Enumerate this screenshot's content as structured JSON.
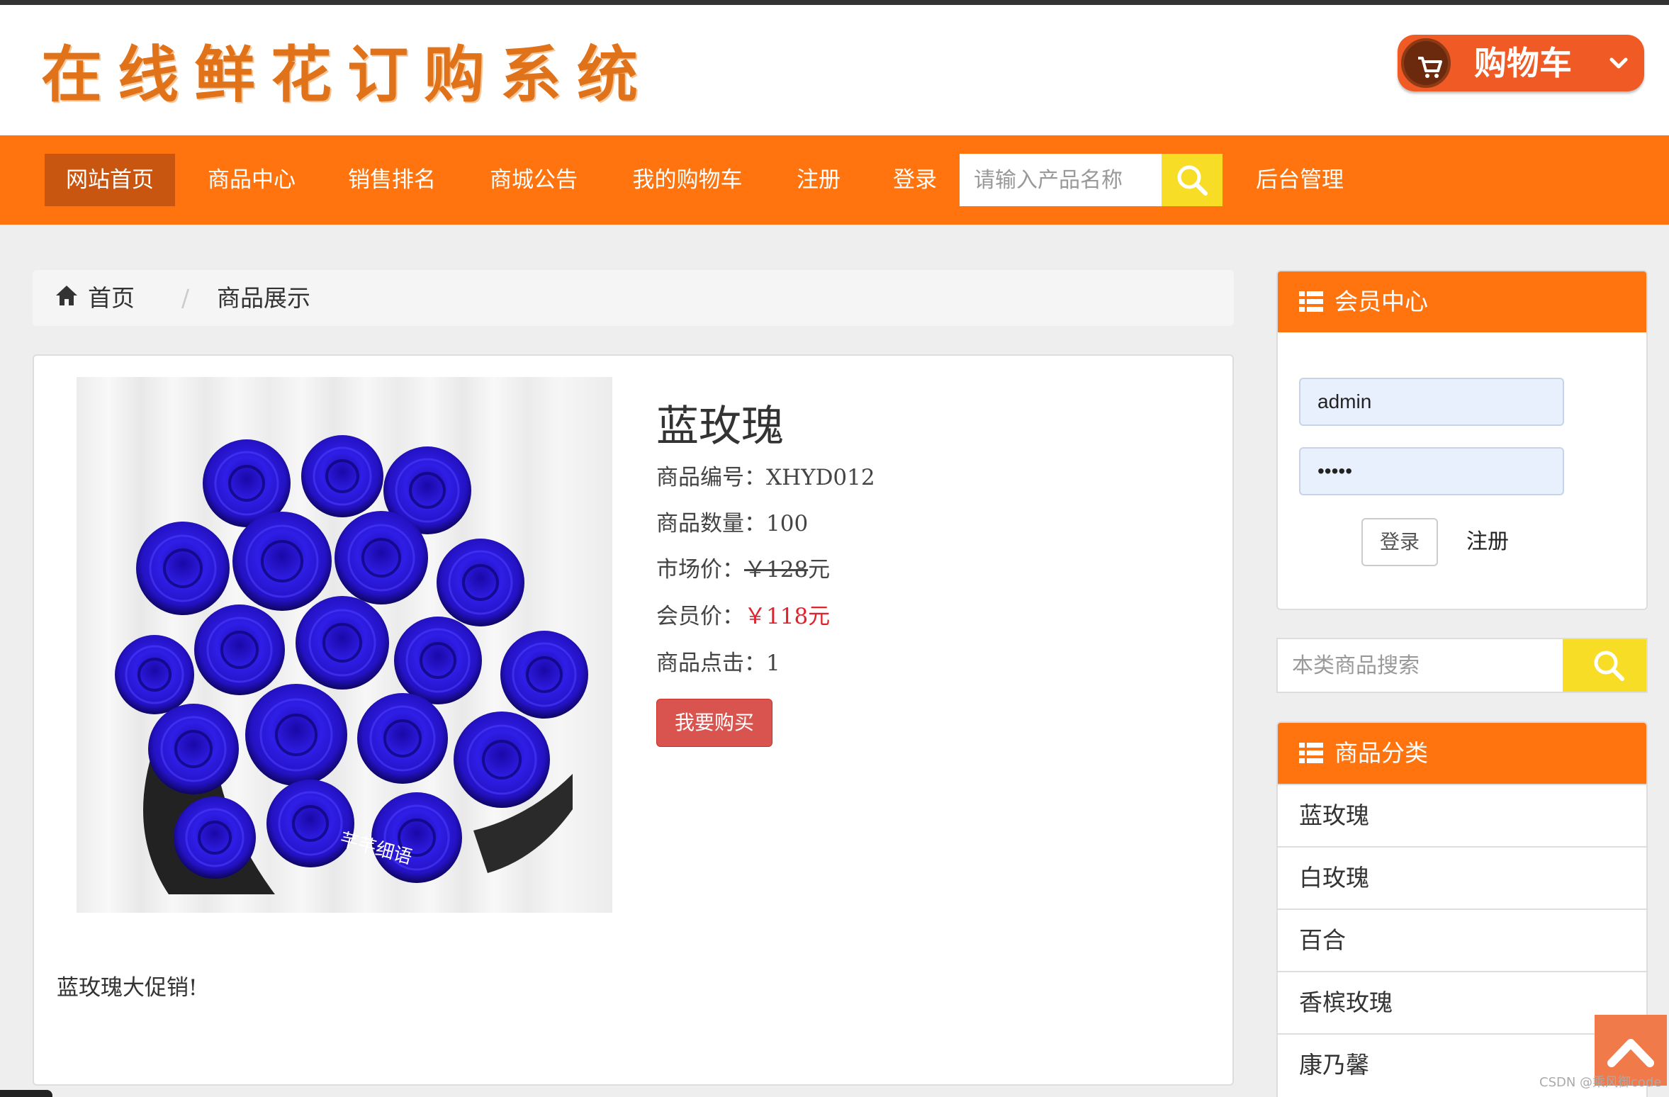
{
  "header": {
    "logo_text": "在线鲜花订购系统",
    "cart_label": "购物车"
  },
  "nav": {
    "items": [
      "网站首页",
      "商品中心",
      "销售排名",
      "商城公告",
      "我的购物车",
      "注册",
      "登录"
    ],
    "active_index": 0,
    "search_placeholder": "请输入产品名称",
    "admin_label": "后台管理"
  },
  "breadcrumb": {
    "home": "首页",
    "separator": "/",
    "current": "商品展示"
  },
  "product": {
    "name": "蓝玫瑰",
    "code_label": "商品编号：",
    "code": "XHYD012",
    "quantity_label": "商品数量：",
    "quantity": "100",
    "market_price_label": "市场价：",
    "market_price": "￥128",
    "market_price_unit": "元",
    "member_price_label": "会员价：",
    "member_price": "￥118元",
    "clicks_label": "商品点击：",
    "clicks": "1",
    "buy_label": "我要购买",
    "description": "蓝玫瑰大促销!",
    "image_watermark": "芊芊细语"
  },
  "member_center": {
    "title": "会员中心",
    "username": "admin",
    "password": "•••••",
    "login_label": "登录",
    "register_label": "注册"
  },
  "category_search": {
    "placeholder": "本类商品搜索"
  },
  "categories": {
    "title": "商品分类",
    "items": [
      "蓝玫瑰",
      "白玫瑰",
      "百合",
      "香槟玫瑰",
      "康乃馨"
    ]
  },
  "watermark": "CSDN @乘风御code",
  "colors": {
    "nav_orange": "#ff740e",
    "nav_active": "#c95610",
    "search_yellow": "#f8dd27",
    "buy_red": "#d9534f",
    "price_red": "#e0222d",
    "logo_orange": "#e0731a"
  },
  "icons": {
    "cart": "shopping-cart-icon",
    "search": "search-icon",
    "home": "home-icon",
    "list": "list-icon",
    "chevron": "chevron-down-icon",
    "back_to_top": "chevron-up-icon"
  }
}
